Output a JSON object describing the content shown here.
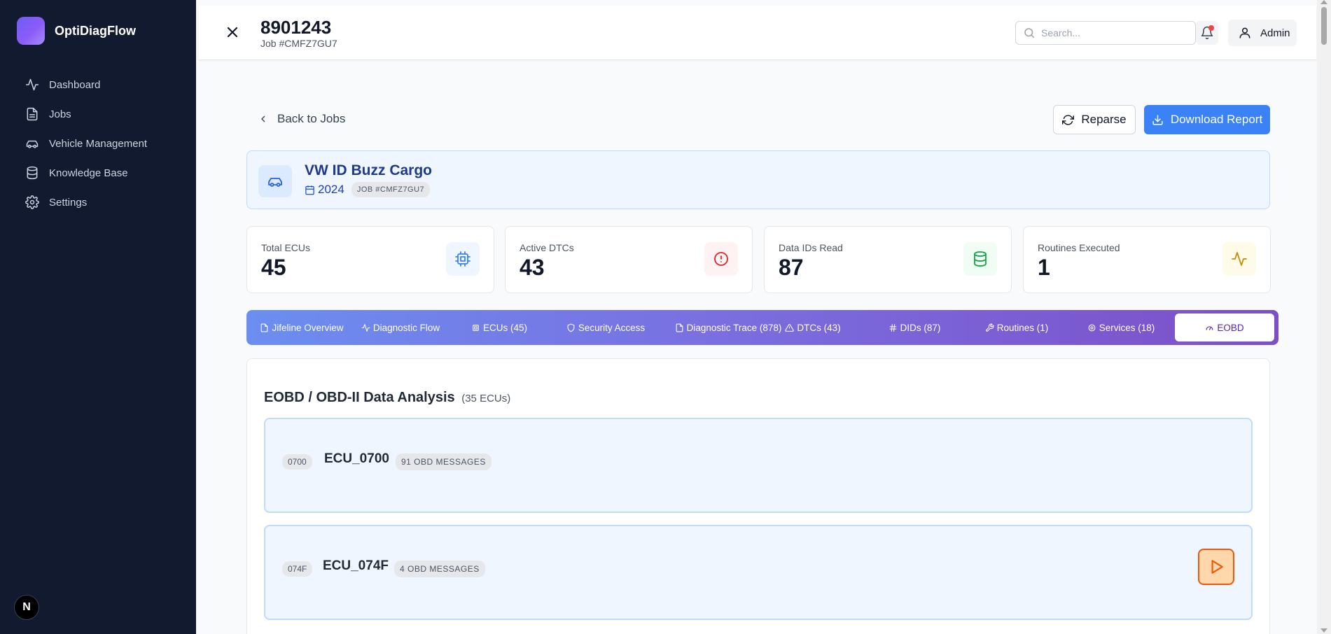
{
  "app": {
    "name": "OptiDiagFlow",
    "footer_badge": "N"
  },
  "sidebar": {
    "items": [
      {
        "label": "Dashboard",
        "icon": "activity-icon"
      },
      {
        "label": "Jobs",
        "icon": "file-icon"
      },
      {
        "label": "Vehicle Management",
        "icon": "car-icon"
      },
      {
        "label": "Knowledge Base",
        "icon": "database-icon"
      },
      {
        "label": "Settings",
        "icon": "gear-icon"
      }
    ]
  },
  "header": {
    "title": "8901243",
    "subtitle": "Job #CMFZ7GU7",
    "search_placeholder": "Search...",
    "user_label": "Admin",
    "has_notification": true
  },
  "actions": {
    "back_label": "Back to Jobs",
    "reparse_label": "Reparse",
    "download_label": "Download Report"
  },
  "vehicle": {
    "name": "VW ID Buzz Cargo",
    "year": "2024",
    "job_tag": "JOB #CMFZ7GU7"
  },
  "stats": [
    {
      "label": "Total ECUs",
      "value": "45",
      "icon": "chip-icon",
      "color": "#3b82f6",
      "bg": "#eff6ff"
    },
    {
      "label": "Active DTCs",
      "value": "43",
      "icon": "alert-circle-icon",
      "color": "#dc2626",
      "bg": "#fef2f2"
    },
    {
      "label": "Data IDs Read",
      "value": "87",
      "icon": "database-icon",
      "color": "#16a34a",
      "bg": "#f0fdf4"
    },
    {
      "label": "Routines Executed",
      "value": "1",
      "icon": "activity-icon",
      "color": "#ca8a04",
      "bg": "#fefce8"
    }
  ],
  "tabs": [
    {
      "label": "Jifeline Overview",
      "icon": "file-icon"
    },
    {
      "label": "Diagnostic Flow",
      "icon": "activity-icon"
    },
    {
      "label": "ECUs (45)",
      "icon": "chip-icon"
    },
    {
      "label": "Security Access",
      "icon": "shield-icon"
    },
    {
      "label": "Diagnostic Trace (878)",
      "icon": "file-icon"
    },
    {
      "label": "DTCs (43)",
      "icon": "warning-icon"
    },
    {
      "label": "DIDs (87)",
      "icon": "hash-icon"
    },
    {
      "label": "Routines (1)",
      "icon": "wrench-icon"
    },
    {
      "label": "Services (18)",
      "icon": "gear-icon"
    },
    {
      "label": "EOBD",
      "icon": "gauge-icon",
      "active": true
    }
  ],
  "eobd": {
    "title": "EOBD / OBD-II Data Analysis",
    "subtitle": "(35 ECUs)",
    "ecus": [
      {
        "address": "0700",
        "name": "ECU_0700",
        "count": "91 OBD MESSAGES"
      },
      {
        "address": "074F",
        "name": "ECU_074F",
        "count": "4 OBD MESSAGES"
      }
    ]
  },
  "colors": {
    "sidebar": "#111a2e",
    "accent": "#3b82f6",
    "tab_active": "#5b21b6"
  }
}
